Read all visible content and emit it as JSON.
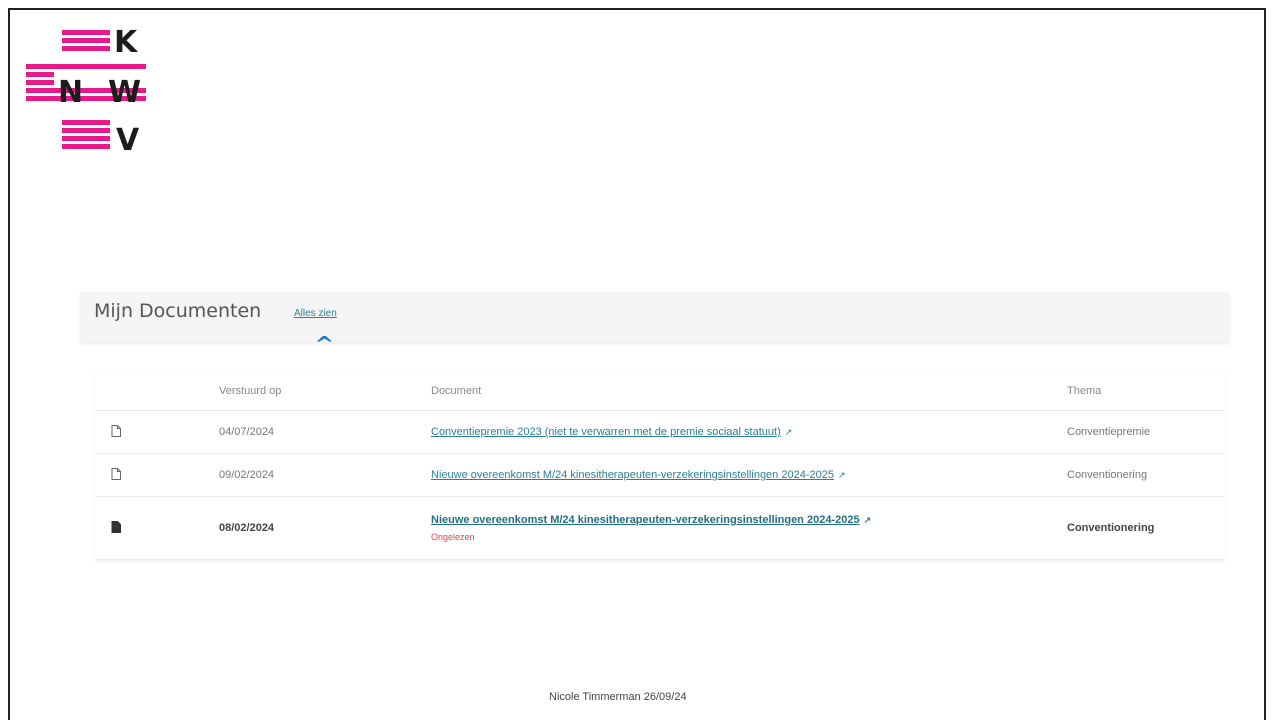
{
  "logo": {
    "letters": [
      "K",
      "N",
      "W",
      "V"
    ],
    "brand_color": "#e5198a",
    "text_color": "#1c1c1c"
  },
  "documents": {
    "title": "Mijn Documenten",
    "see_all_label": "Alles zien",
    "pointer_glyph": "^",
    "headers": {
      "sent_on": "Verstuurd op",
      "document": "Document",
      "theme": "Thema"
    },
    "rows": [
      {
        "icon": "file-outline-icon",
        "date": "04/07/2024",
        "document": "Conventiepremie 2023 (niet te verwarren met de premie sociaal statuut)",
        "theme": "Conventiepremie",
        "unread": false
      },
      {
        "icon": "file-outline-icon",
        "date": "09/02/2024",
        "document": "Nieuwe overeenkomst M/24 kinesitherapeuten-verzekeringsinstellingen 2024-2025",
        "theme": "Conventionering",
        "unread": false
      },
      {
        "icon": "file-filled-icon",
        "date": "08/02/2024",
        "document": "Nieuwe overeenkomst M/24 kinesitherapeuten-verzekeringsinstellingen 2024-2025",
        "theme": "Conventionering",
        "unread": true,
        "unread_label": "Ongelezen"
      }
    ],
    "link_color": "#2b7f96",
    "unread_color": "#d24b4b"
  },
  "footer": {
    "text": "Nicole Timmerman 26/09/24"
  }
}
